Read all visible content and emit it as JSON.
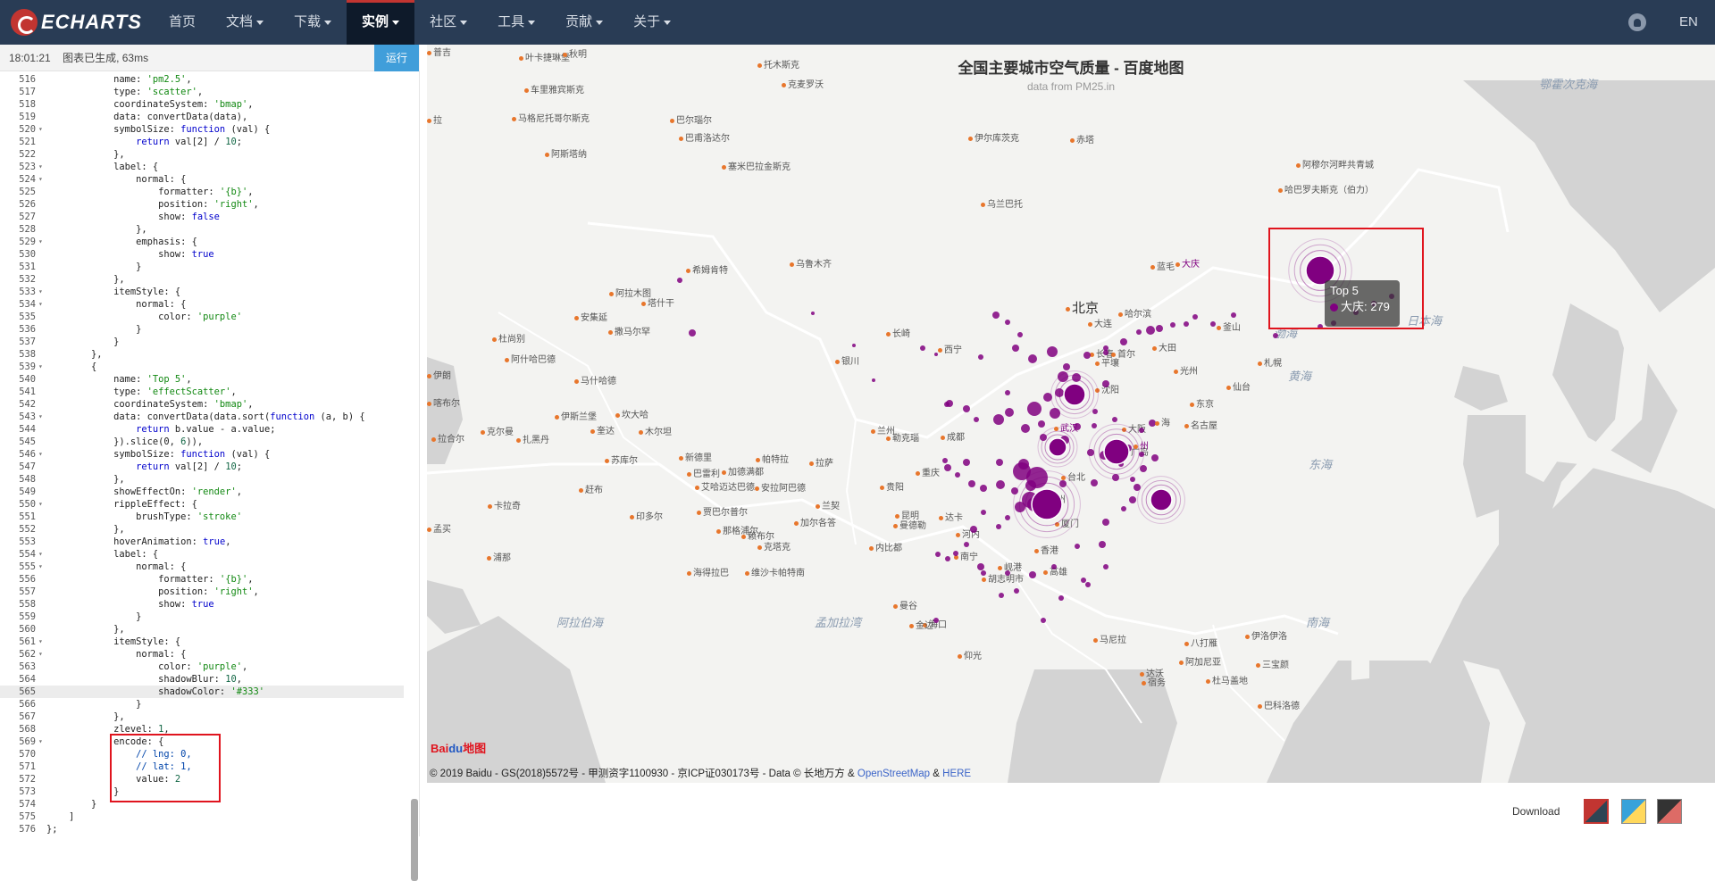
{
  "navbar": {
    "logo_text": "ECHARTS",
    "items": [
      {
        "label": "首页"
      },
      {
        "label": "文档"
      },
      {
        "label": "下载"
      },
      {
        "label": "实例"
      },
      {
        "label": "社区"
      },
      {
        "label": "工具"
      },
      {
        "label": "贡献"
      },
      {
        "label": "关于"
      }
    ],
    "lang": "EN",
    "github_icon": "github-icon"
  },
  "status": {
    "time": "18:01:21",
    "message": "图表已生成, 63ms",
    "run_label": "运行"
  },
  "code_lines": [
    {
      "n": "516",
      "t": "            name: 'pm2.5',"
    },
    {
      "n": "517",
      "t": "            type: 'scatter',"
    },
    {
      "n": "518",
      "t": "            coordinateSystem: 'bmap',"
    },
    {
      "n": "519",
      "t": "            data: convertData(data),"
    },
    {
      "n": "520",
      "t": "            symbolSize: function (val) {"
    },
    {
      "n": "521",
      "t": "                return val[2] / 10;"
    },
    {
      "n": "522",
      "t": "            },"
    },
    {
      "n": "523",
      "t": "            label: {"
    },
    {
      "n": "524",
      "t": "                normal: {"
    },
    {
      "n": "525",
      "t": "                    formatter: '{b}',"
    },
    {
      "n": "526",
      "t": "                    position: 'right',"
    },
    {
      "n": "527",
      "t": "                    show: false"
    },
    {
      "n": "528",
      "t": "                },"
    },
    {
      "n": "529",
      "t": "                emphasis: {"
    },
    {
      "n": "530",
      "t": "                    show: true"
    },
    {
      "n": "531",
      "t": "                }"
    },
    {
      "n": "532",
      "t": "            },"
    },
    {
      "n": "533",
      "t": "            itemStyle: {"
    },
    {
      "n": "534",
      "t": "                normal: {"
    },
    {
      "n": "535",
      "t": "                    color: 'purple'"
    },
    {
      "n": "536",
      "t": "                }"
    },
    {
      "n": "537",
      "t": "            }"
    },
    {
      "n": "538",
      "t": "        },"
    },
    {
      "n": "539",
      "t": "        {"
    },
    {
      "n": "540",
      "t": "            name: 'Top 5',"
    },
    {
      "n": "541",
      "t": "            type: 'effectScatter',"
    },
    {
      "n": "542",
      "t": "            coordinateSystem: 'bmap',"
    },
    {
      "n": "543",
      "t": "            data: convertData(data.sort(function (a, b) {"
    },
    {
      "n": "544",
      "t": "                return b.value - a.value;"
    },
    {
      "n": "545",
      "t": "            }).slice(0, 6)),"
    },
    {
      "n": "546",
      "t": "            symbolSize: function (val) {"
    },
    {
      "n": "547",
      "t": "                return val[2] / 10;"
    },
    {
      "n": "548",
      "t": "            },"
    },
    {
      "n": "549",
      "t": "            showEffectOn: 'render',"
    },
    {
      "n": "550",
      "t": "            rippleEffect: {"
    },
    {
      "n": "551",
      "t": "                brushType: 'stroke'"
    },
    {
      "n": "552",
      "t": "            },"
    },
    {
      "n": "553",
      "t": "            hoverAnimation: true,"
    },
    {
      "n": "554",
      "t": "            label: {"
    },
    {
      "n": "555",
      "t": "                normal: {"
    },
    {
      "n": "556",
      "t": "                    formatter: '{b}',"
    },
    {
      "n": "557",
      "t": "                    position: 'right',"
    },
    {
      "n": "558",
      "t": "                    show: true"
    },
    {
      "n": "559",
      "t": "                }"
    },
    {
      "n": "560",
      "t": "            },"
    },
    {
      "n": "561",
      "t": "            itemStyle: {"
    },
    {
      "n": "562",
      "t": "                normal: {"
    },
    {
      "n": "563",
      "t": "                    color: 'purple',"
    },
    {
      "n": "564",
      "t": "                    shadowBlur: 10,"
    },
    {
      "n": "565",
      "t": "                    shadowColor: '#333'"
    },
    {
      "n": "566",
      "t": "                }"
    },
    {
      "n": "567",
      "t": "            },"
    },
    {
      "n": "568",
      "t": "            zlevel: 1,"
    },
    {
      "n": "569",
      "t": "            encode: {"
    },
    {
      "n": "570",
      "t": "                // lng: 0,"
    },
    {
      "n": "571",
      "t": "                // lat: 1,"
    },
    {
      "n": "572",
      "t": "                value: 2"
    },
    {
      "n": "573",
      "t": "            }"
    },
    {
      "n": "574",
      "t": "        }"
    },
    {
      "n": "575",
      "t": "    ]"
    },
    {
      "n": "576",
      "t": "};"
    }
  ],
  "fold_lines": [
    "520",
    "523",
    "524",
    "529",
    "533",
    "534",
    "539",
    "543",
    "546",
    "550",
    "554",
    "555",
    "561",
    "562",
    "569"
  ],
  "highlight_line": "565",
  "map": {
    "title": "全国主要城市空气质量 - 百度地图",
    "subtitle": "data from PM25.in",
    "tooltip_title": "Top 5",
    "tooltip_value": "大庆: 279",
    "top5_label": "大庆",
    "city_labels": [
      "北京",
      "武汉",
      "州",
      "海"
    ],
    "places": [
      "叶卡捷琳堡",
      "秋明",
      "托木斯克",
      "车里雅宾斯克",
      "克麦罗沃",
      "拉",
      "马格尼托哥尔斯克",
      "巴尔瑙尔",
      "巴甫洛达尔",
      "伊尔库茨克",
      "赤塔",
      "阿斯塔纳",
      "塞米巴拉金斯克",
      "阿穆尔河畔共青城",
      "乌兰巴托",
      "哈巴罗夫斯克（伯力）",
      "乌鲁木齐",
      "希姆肯特",
      "阿拉木图",
      "塔什干",
      "安集延",
      "撒马尔罕",
      "杜尚别",
      "阿什哈巴德",
      "马什哈德",
      "喀布尔",
      "伊斯兰堡",
      "坎大哈",
      "奎达",
      "伊朗",
      "拉合尔",
      "克尔曼",
      "扎黑丹",
      "木尔坦",
      "苏库尔",
      "新德里",
      "巴雷利",
      "帕特拉",
      "加德满都",
      "勒克瑙",
      "拉萨",
      "赶布",
      "卡拉奇",
      "艾哈迈达巴德",
      "安拉阿巴德",
      "印多尔",
      "贾巴尔普尔",
      "兰契",
      "加尔各答",
      "那格浦尔",
      "赖布尔",
      "孟买",
      "浦那",
      "克塔克",
      "海得拉巴",
      "维沙卡帕特南",
      "达卡",
      "曼德勒",
      "内比都",
      "河内",
      "海口",
      "岘港",
      "曼谷",
      "金边",
      "胡志明市",
      "仰光",
      "蓝毛",
      "哈尔滨",
      "长春",
      "沈阳",
      "大连",
      "平壤",
      "首尔",
      "大田",
      "光州",
      "釜山",
      "札幌",
      "仙台",
      "东京",
      "名古屋",
      "大阪",
      "广岛",
      "长崎",
      "银川",
      "西宁",
      "兰州",
      "成都",
      "重庆",
      "贵阳",
      "昆明",
      "南宁",
      "香港",
      "台北",
      "福州",
      "厦门",
      "高雄",
      "马尼拉",
      "宿务",
      "达沃",
      "八打雁",
      "伊洛伊洛",
      "阿加尼亚",
      "杜马盖地",
      "三宝颜",
      "巴科洛德",
      "普吉"
    ],
    "regions": [
      "鄂霍次克海",
      "日本海",
      "渤海",
      "黄海",
      "东海",
      "南海",
      "阿拉伯海",
      "孟加拉湾"
    ],
    "attribution_text": "© 2019 Baidu - GS(2018)5572号 - 甲测资字1100930 - 京ICP证030173号 - Data © 长地万方 &",
    "attribution_link1": "OpenStreetMap",
    "attribution_amp": "&",
    "attribution_link2": "HERE",
    "baidu_logo_bai": "Bai",
    "baidu_logo_du": "du",
    "baidu_logo_map": "地图"
  },
  "toolbar": {
    "download_label": "Download",
    "themes": [
      {
        "name": "default",
        "color": "#c23531"
      },
      {
        "name": "light",
        "color": "#37a2da"
      },
      {
        "name": "dark",
        "color": "#333"
      }
    ]
  },
  "colors": {
    "navbar": "#293c55",
    "accent": "#c23531",
    "run_button": "#409eda",
    "scatter": "#800080",
    "highlight_box": "#e0141e"
  }
}
